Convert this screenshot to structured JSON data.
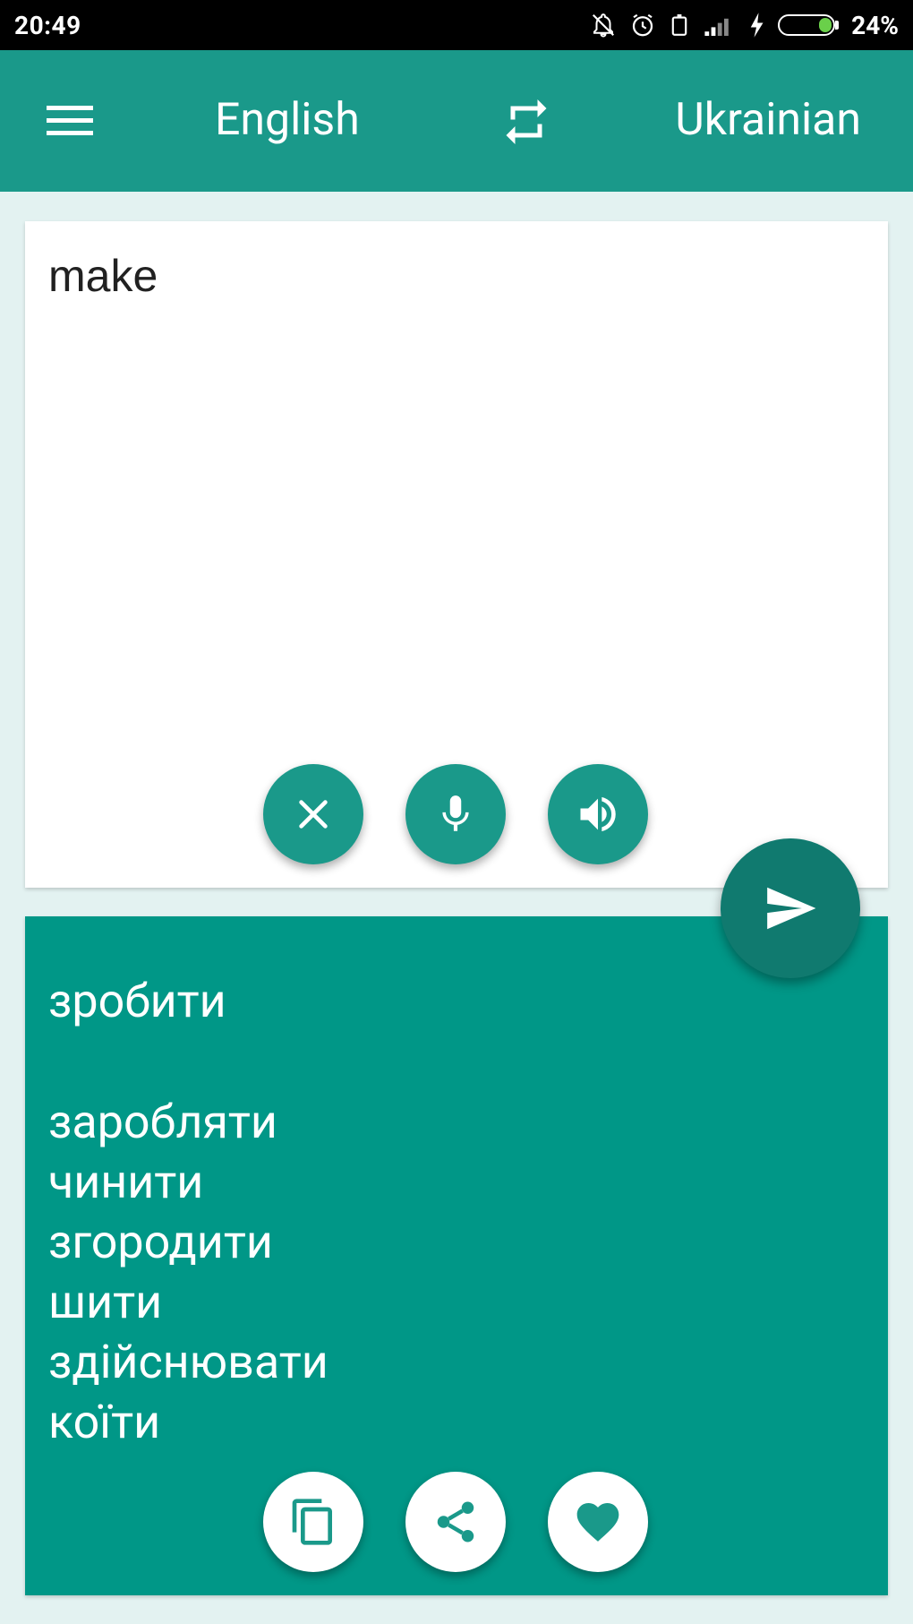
{
  "status_bar": {
    "time": "20:49",
    "battery_percent": "24%"
  },
  "toolbar": {
    "source_language": "English",
    "target_language": "Ukrainian"
  },
  "input": {
    "text": "make"
  },
  "output": {
    "primary": "зробити",
    "alternatives": [
      "заробляти",
      "чинити",
      "згородити",
      "шити",
      "здійснювати",
      "коїти"
    ]
  },
  "colors": {
    "accent": "#1a998a",
    "output_bg": "#009787",
    "send_fab": "#107a6f",
    "page_bg": "#e3f2f1"
  },
  "icons": {
    "status": [
      "bell-off-icon",
      "alarm-icon",
      "battery-saver-icon",
      "signal-icon",
      "charging-icon",
      "battery-icon"
    ],
    "toolbar": [
      "menu-icon",
      "swap-icon"
    ],
    "input_actions": [
      "close-icon",
      "microphone-icon",
      "speaker-icon"
    ],
    "send": "send-icon",
    "output_actions": [
      "copy-icon",
      "share-icon",
      "heart-icon"
    ]
  }
}
